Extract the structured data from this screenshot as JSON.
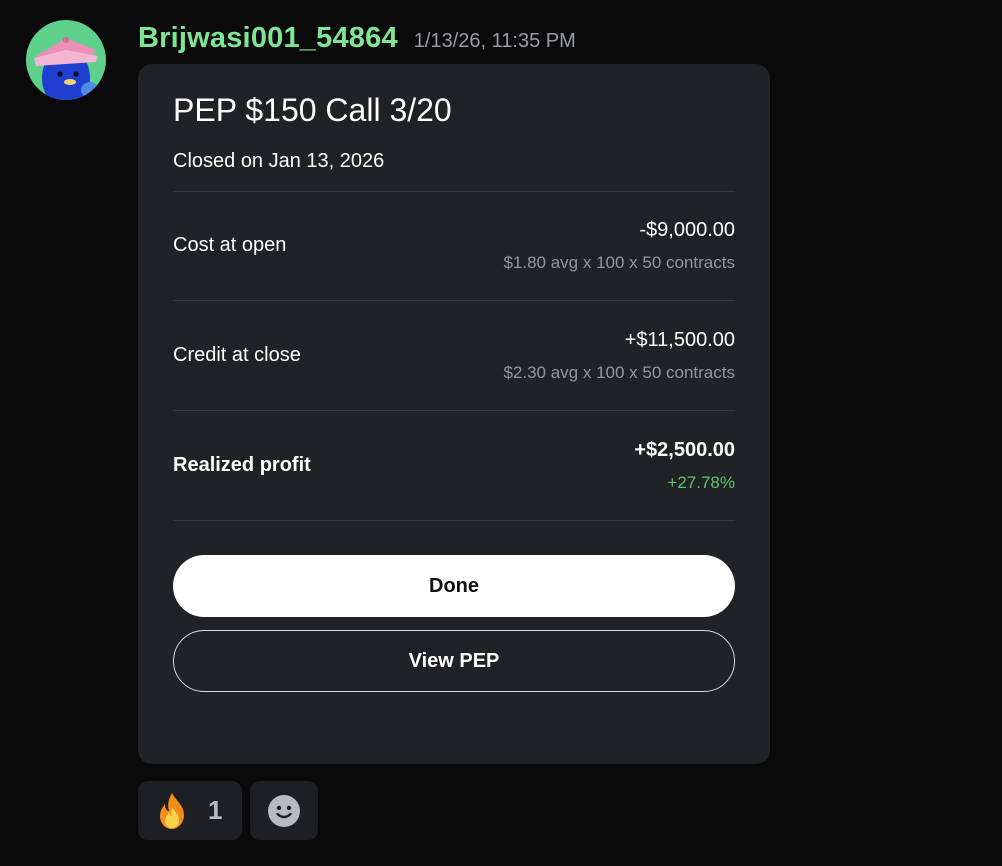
{
  "message": {
    "username": "Brijwasi001_54864",
    "timestamp": "1/13/26, 11:35 PM",
    "avatar_icon": "penguin-with-pink-hat-avatar"
  },
  "card": {
    "title": "PEP $150 Call 3/20",
    "subtitle": "Closed on Jan 13, 2026",
    "rows": [
      {
        "label": "Cost at open",
        "value": "-$9,000.00",
        "detail": "$1.80 avg x 100 x 50 contracts"
      },
      {
        "label": "Credit at close",
        "value": "+$11,500.00",
        "detail": "$2.30 avg x 100 x 50 contracts"
      },
      {
        "label": "Realized profit",
        "value": "+$2,500.00",
        "detail": "+27.78%"
      }
    ],
    "done_label": "Done",
    "view_label": "View PEP"
  },
  "reactions": {
    "fire_icon": "fire-emoji-icon",
    "fire_count": "1",
    "add_reaction_icon": "add-reaction-smiley-icon"
  },
  "colors": {
    "username": "#7ee594",
    "profit_green": "#5ec46a",
    "card_background": "#212226",
    "page_background": "#0a0a0b"
  }
}
